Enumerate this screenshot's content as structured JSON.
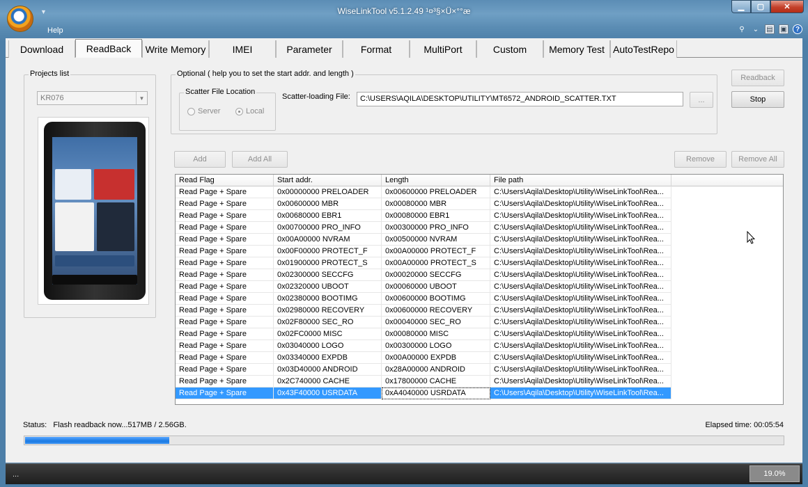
{
  "window": {
    "title": "WiseLinkTool v5.1.2.49 ¹¤³§×Ü×°°æ",
    "minimize_icon": "minimize-icon",
    "maximize_icon": "maximize-icon",
    "close_icon": "close-icon"
  },
  "menu": {
    "help": "Help"
  },
  "tabs": [
    {
      "label": "Download"
    },
    {
      "label": "ReadBack",
      "active": true
    },
    {
      "label": "Write Memory"
    },
    {
      "label": "IMEI"
    },
    {
      "label": "Parameter"
    },
    {
      "label": "Format"
    },
    {
      "label": "MultiPort"
    },
    {
      "label": "Custom"
    },
    {
      "label": "Memory Test"
    },
    {
      "label": "AutoTestRepo"
    }
  ],
  "projects": {
    "legend": "Projects list",
    "selected": "KR076"
  },
  "optional": {
    "legend": "Optional ( help you to set the start addr. and length )",
    "scatter_location": {
      "legend": "Scatter File Location",
      "server": "Server",
      "local": "Local",
      "selected": "Local"
    },
    "scatter_label": "Scatter-loading File:",
    "scatter_path": "C:\\USERS\\AQILA\\DESKTOP\\UTILITY\\MT6572_ANDROID_SCATTER.TXT",
    "browse": "..."
  },
  "buttons": {
    "readback": "Readback",
    "stop": "Stop",
    "add": "Add",
    "add_all": "Add All",
    "remove": "Remove",
    "remove_all": "Remove All"
  },
  "table": {
    "columns": [
      "Read Flag",
      "Start addr.",
      "Length",
      "File path"
    ],
    "rows": [
      [
        "Read Page + Spare",
        "0x00000000 PRELOADER",
        "0x00600000 PRELOADER",
        "C:\\Users\\Aqila\\Desktop\\Utility\\WiseLinkTool\\Rea..."
      ],
      [
        "Read Page + Spare",
        "0x00600000 MBR",
        "0x00080000 MBR",
        "C:\\Users\\Aqila\\Desktop\\Utility\\WiseLinkTool\\Rea..."
      ],
      [
        "Read Page + Spare",
        "0x00680000 EBR1",
        "0x00080000 EBR1",
        "C:\\Users\\Aqila\\Desktop\\Utility\\WiseLinkTool\\Rea..."
      ],
      [
        "Read Page + Spare",
        "0x00700000 PRO_INFO",
        "0x00300000 PRO_INFO",
        "C:\\Users\\Aqila\\Desktop\\Utility\\WiseLinkTool\\Rea..."
      ],
      [
        "Read Page + Spare",
        "0x00A00000 NVRAM",
        "0x00500000 NVRAM",
        "C:\\Users\\Aqila\\Desktop\\Utility\\WiseLinkTool\\Rea..."
      ],
      [
        "Read Page + Spare",
        "0x00F00000 PROTECT_F",
        "0x00A00000 PROTECT_F",
        "C:\\Users\\Aqila\\Desktop\\Utility\\WiseLinkTool\\Rea..."
      ],
      [
        "Read Page + Spare",
        "0x01900000 PROTECT_S",
        "0x00A00000 PROTECT_S",
        "C:\\Users\\Aqila\\Desktop\\Utility\\WiseLinkTool\\Rea..."
      ],
      [
        "Read Page + Spare",
        "0x02300000 SECCFG",
        "0x00020000 SECCFG",
        "C:\\Users\\Aqila\\Desktop\\Utility\\WiseLinkTool\\Rea..."
      ],
      [
        "Read Page + Spare",
        "0x02320000 UBOOT",
        "0x00060000 UBOOT",
        "C:\\Users\\Aqila\\Desktop\\Utility\\WiseLinkTool\\Rea..."
      ],
      [
        "Read Page + Spare",
        "0x02380000 BOOTIMG",
        "0x00600000 BOOTIMG",
        "C:\\Users\\Aqila\\Desktop\\Utility\\WiseLinkTool\\Rea..."
      ],
      [
        "Read Page + Spare",
        "0x02980000 RECOVERY",
        "0x00600000 RECOVERY",
        "C:\\Users\\Aqila\\Desktop\\Utility\\WiseLinkTool\\Rea..."
      ],
      [
        "Read Page + Spare",
        "0x02F80000 SEC_RO",
        "0x00040000 SEC_RO",
        "C:\\Users\\Aqila\\Desktop\\Utility\\WiseLinkTool\\Rea..."
      ],
      [
        "Read Page + Spare",
        "0x02FC0000 MISC",
        "0x00080000 MISC",
        "C:\\Users\\Aqila\\Desktop\\Utility\\WiseLinkTool\\Rea..."
      ],
      [
        "Read Page + Spare",
        "0x03040000 LOGO",
        "0x00300000 LOGO",
        "C:\\Users\\Aqila\\Desktop\\Utility\\WiseLinkTool\\Rea..."
      ],
      [
        "Read Page + Spare",
        "0x03340000 EXPDB",
        "0x00A00000 EXPDB",
        "C:\\Users\\Aqila\\Desktop\\Utility\\WiseLinkTool\\Rea..."
      ],
      [
        "Read Page + Spare",
        "0x03D40000 ANDROID",
        "0x28A00000 ANDROID",
        "C:\\Users\\Aqila\\Desktop\\Utility\\WiseLinkTool\\Rea..."
      ],
      [
        "Read Page + Spare",
        "0x2C740000 CACHE",
        "0x17800000 CACHE",
        "C:\\Users\\Aqila\\Desktop\\Utility\\WiseLinkTool\\Rea..."
      ],
      [
        "Read Page + Spare",
        "0x43F40000 USRDATA",
        "0xA4040000 USRDATA",
        "C:\\Users\\Aqila\\Desktop\\Utility\\WiseLinkTool\\Rea..."
      ]
    ],
    "selected_row": 17
  },
  "status": {
    "label": "Status:",
    "text": "Flash readback now...517MB / 2.56GB.",
    "elapsed": "Elapsed time: 00:05:54",
    "progress_fraction": 0.19
  },
  "statusbar": {
    "left": "...",
    "percent": "19.0%"
  },
  "colors": {
    "selection": "#3399ff",
    "progress": "#1a7ae4",
    "titlebar": "#5b8db5"
  }
}
